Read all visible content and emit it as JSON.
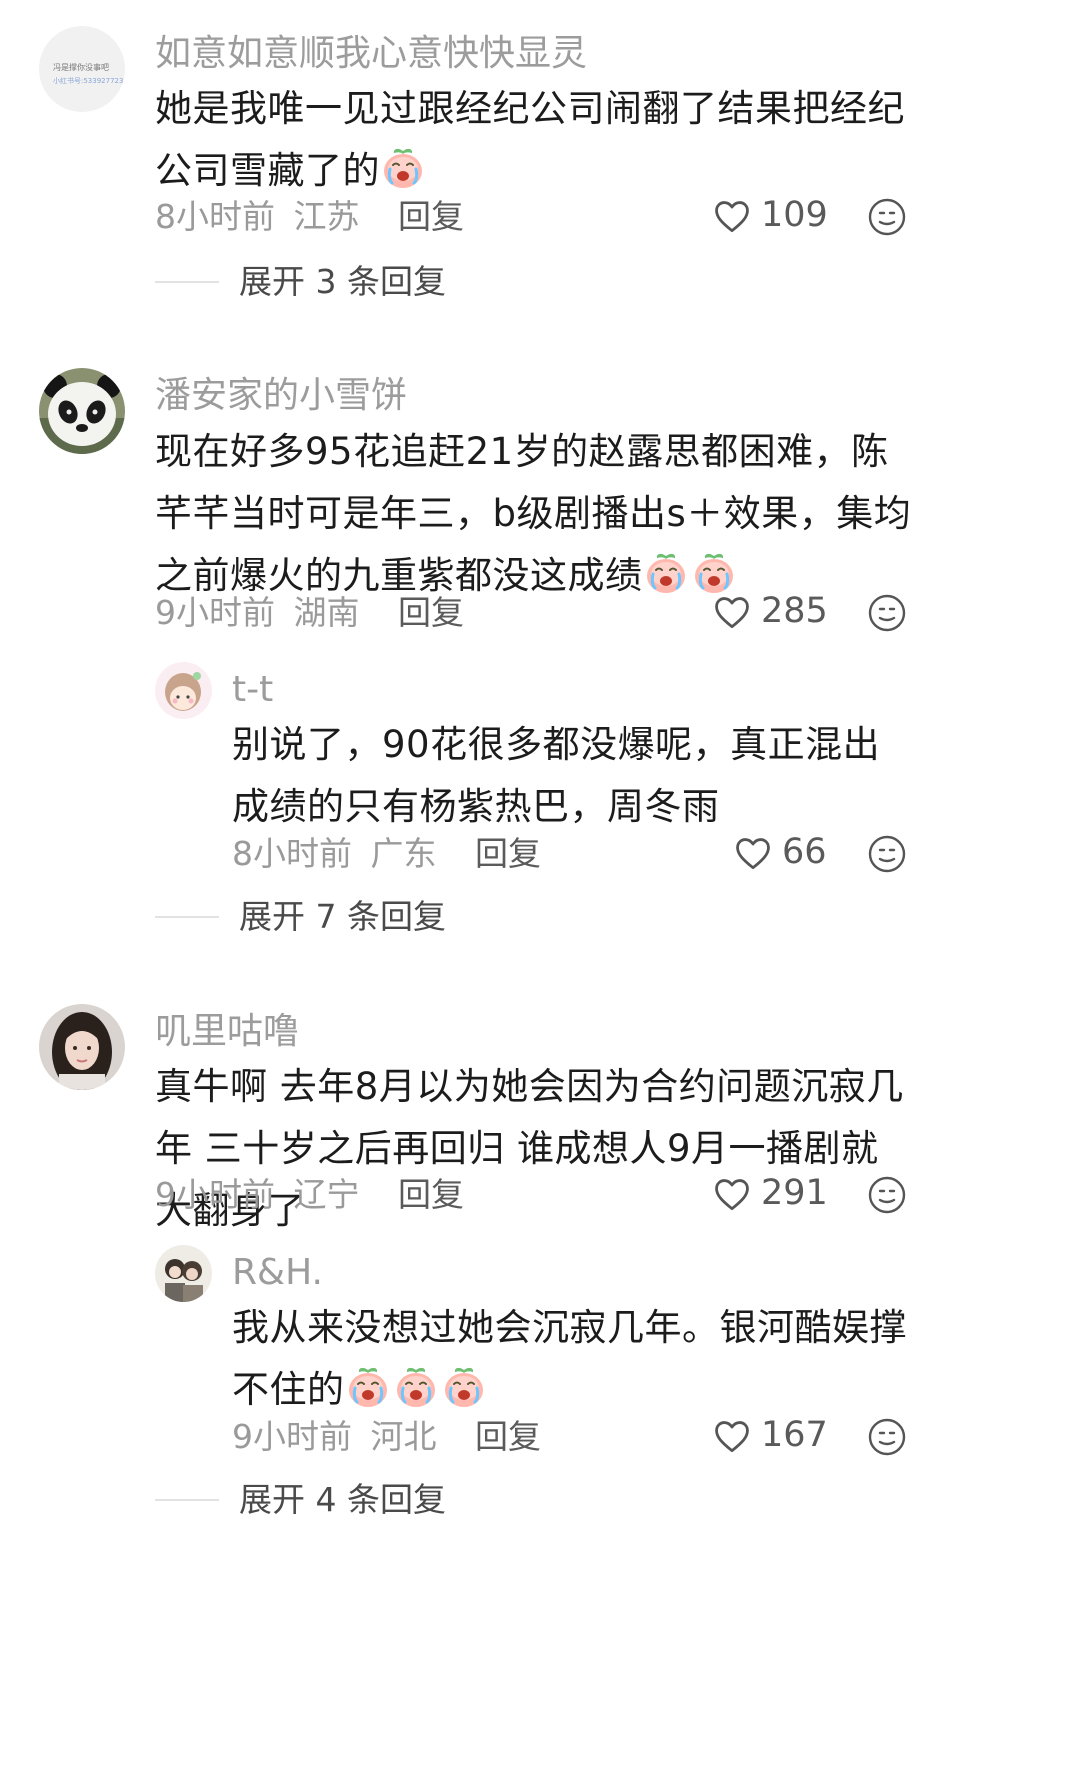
{
  "comments": [
    {
      "username": "如意如意顺我心意快快显灵",
      "avatar_lines": [
        "冯是撑你没事吧",
        "小红书号:5339277239"
      ],
      "text": "她是我唯一见过跟经纪公司闹翻了结果把经纪公司雪藏了的",
      "emoji_count": 1,
      "time": "8小时前",
      "location": "江苏",
      "reply_label": "回复",
      "likes": "109",
      "expand_label": "展开 3 条回复"
    },
    {
      "username": "潘安家的小雪饼",
      "text": "现在好多95花追赶21岁的赵露思都困难，陈芊芊当时可是年三，b级剧播出s＋效果，集均之前爆火的九重紫都没这成绩",
      "emoji_count": 2,
      "time": "9小时前",
      "location": "湖南",
      "reply_label": "回复",
      "likes": "285",
      "reply": {
        "username": "t-t",
        "text": "别说了，90花很多都没爆呢，真正混出成绩的只有杨紫热巴，周冬雨",
        "time": "8小时前",
        "location": "广东",
        "reply_label": "回复",
        "likes": "66"
      },
      "expand_label": "展开 7 条回复"
    },
    {
      "username": "叽里咕噜",
      "text": "真牛啊 去年8月以为她会因为合约问题沉寂几年 三十岁之后再回归 谁成想人9月一播剧就大翻身了",
      "time": "9小时前",
      "location": "辽宁",
      "reply_label": "回复",
      "likes": "291",
      "reply": {
        "username": "R&H.",
        "text": "我从来没想过她会沉寂几年。银河酷娱撑不住的",
        "emoji_count": 3,
        "time": "9小时前",
        "location": "河北",
        "reply_label": "回复",
        "likes": "167"
      },
      "expand_label": "展开 4 条回复"
    }
  ],
  "icons": {
    "like": "heart-outline-icon",
    "more": "face-icon",
    "emoji": "crying-peach-emoji"
  },
  "colors": {
    "username": "#9c9c9c",
    "body": "#1c1c1c",
    "meta": "#9a9a9a",
    "divider": "#e2e2e2"
  }
}
